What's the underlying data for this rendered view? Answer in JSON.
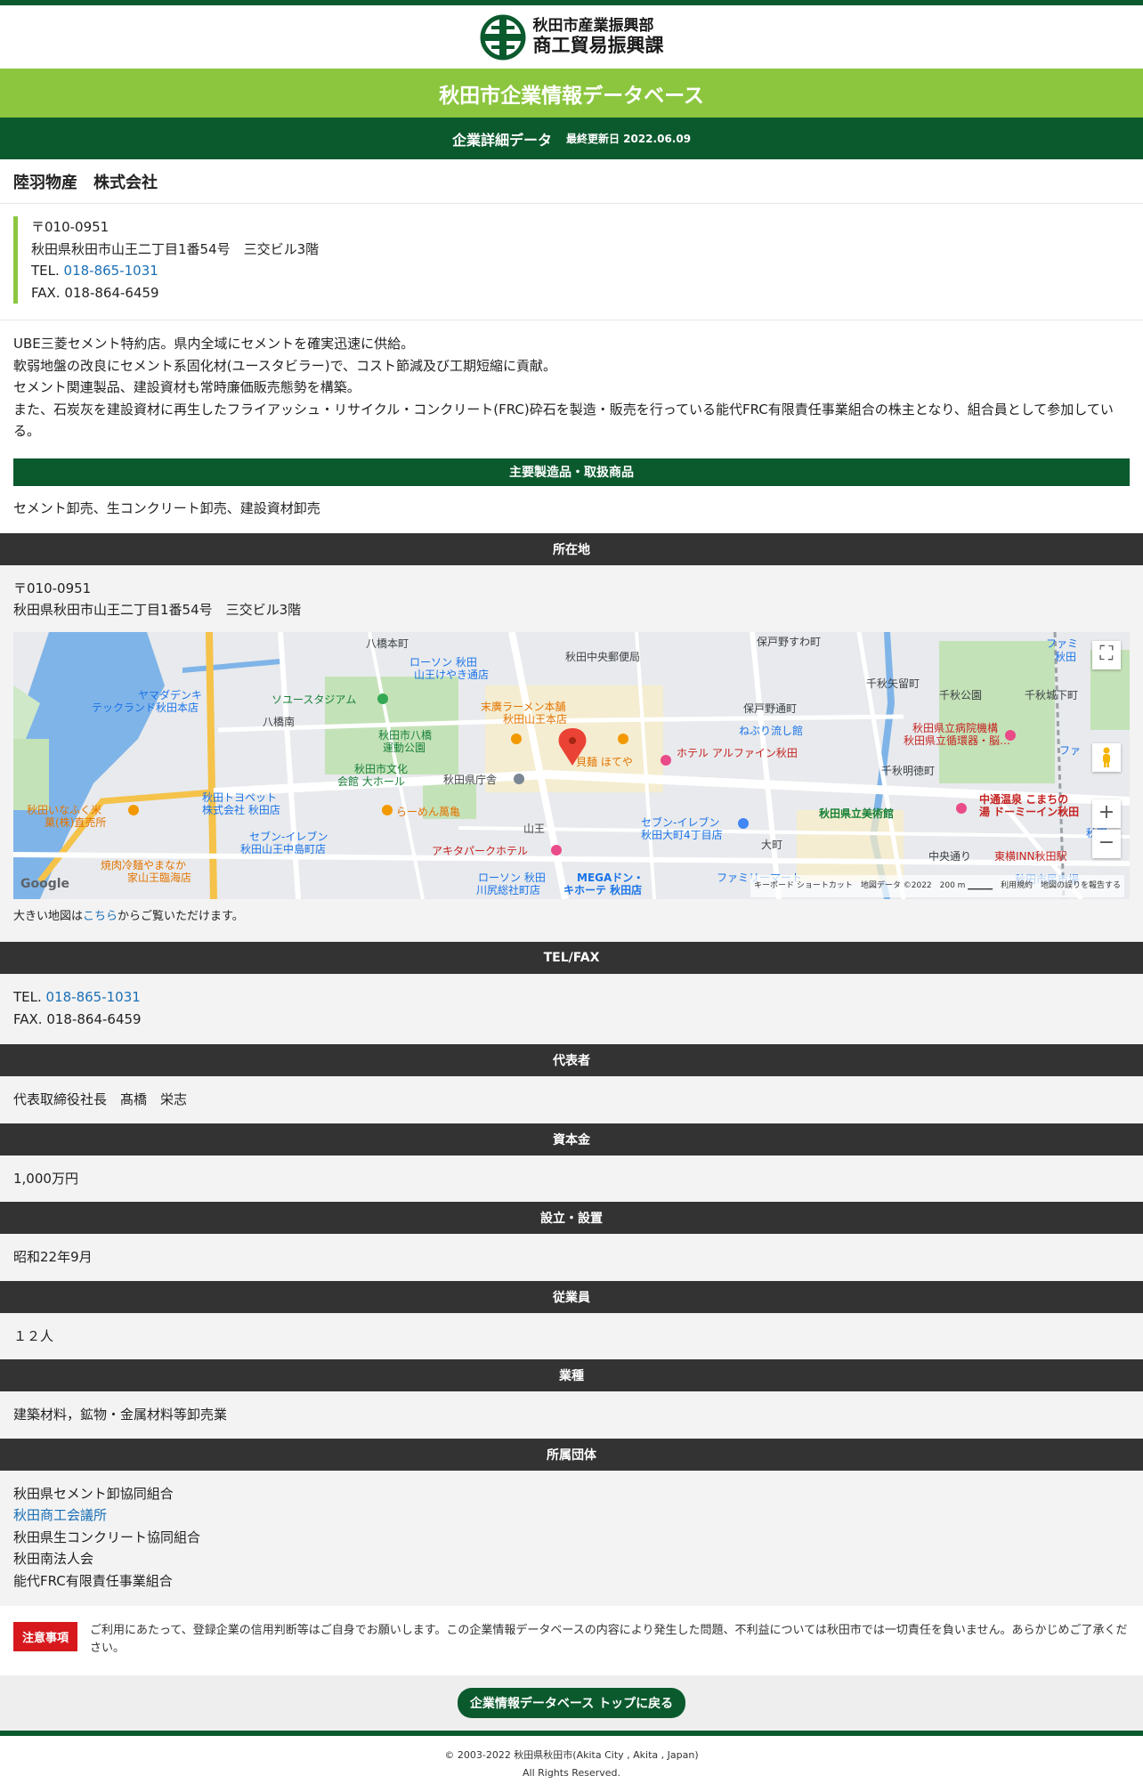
{
  "header": {
    "dept": "秋田市産業振興部",
    "section": "商工貿易振興課",
    "banner": "秋田市企業情報データベース",
    "sub_title": "企業詳細データ",
    "updated": "最終更新日 2022.06.09"
  },
  "company": {
    "name": "陸羽物産　株式会社",
    "zip": "〒010-0951",
    "address": "秋田県秋田市山王二丁目1番54号　三交ビル3階",
    "tel_prefix": "TEL. ",
    "tel": "018-865-1031",
    "fax": "FAX. 018-864-6459"
  },
  "description": [
    "UBE三菱セメント特約店。県内全域にセメントを確実迅速に供給。",
    "軟弱地盤の改良にセメント系固化材(ユースタビラー)で、コスト節減及び工期短縮に貢献。",
    "セメント関連製品、建設資材も常時廉価販売態勢を構築。",
    "また、石炭灰を建設資材に再生したフライアッシュ・リサイクル・コンクリート(FRC)砕石を製造・販売を行っている能代FRC有限責任事業組合の株主となり、組合員として参加している。"
  ],
  "products": {
    "heading": "主要製造品・取扱商品",
    "value": "セメント卸売、生コンクリート卸売、建設資材卸売"
  },
  "location": {
    "heading": "所在地",
    "zip": "〒010-0951",
    "address": "秋田県秋田市山王二丁目1番54号　三交ビル3階",
    "map_note_prefix": "大きい地図は",
    "map_note_link": "こちら",
    "map_note_suffix": "からご覧いただけます。"
  },
  "map": {
    "labels": {
      "l1": "八橋本町",
      "l2": "ローソン 秋田",
      "l3": "山王けやき通店",
      "l4": "秋田中央郵便局",
      "l5": "保戸野すわ町",
      "l6": "ヤマダデンキ",
      "l7": "テックランド秋田本店",
      "l8": "ソユースタジアム",
      "l9": "八橋南",
      "l10": "末廣ラーメン本舗",
      "l11": "秋田山王本店",
      "l12": "保戸野通町",
      "l13": "千秋矢留町",
      "l14": "千秋公園",
      "l15": "千秋城下町",
      "l16": "ねぶり流し館",
      "l17": "秋田市八橋",
      "l18": "運動公園",
      "l19": "秋田県立病院機構",
      "l20": "秋田県立循環器・脳…",
      "l21": "秋田市文化",
      "l22": "会館 大ホール",
      "l23": "秋田県庁舎",
      "l24": "貝麺 ほてや",
      "l25": "ホテル アルファイン秋田",
      "l26": "千秋明徳町",
      "l27": "秋田トヨペット",
      "l28": "株式会社 秋田店",
      "l29": "秋田いなふく米",
      "l30": "菓(株)直売所",
      "l31": "らーめん萬亀",
      "l32": "山王",
      "l33": "セブン-イレブン",
      "l34": "秋田大町4丁目店",
      "l35": "秋田県立美術館",
      "l36": "中通温泉 こまちの",
      "l37": "湯 ドーミーイン秋田",
      "l38": "セブン-イレブン",
      "l39": "秋田山王中島町店",
      "l40": "大町",
      "l41": "中央通り",
      "l42": "東横INN秋田駅",
      "l43": "焼肉冷麺やまなか",
      "l44": "家山王臨海店",
      "l45": "アキタパークホテル",
      "l46": "ローソン 秋田",
      "l47": "川尻総社町店",
      "l48": "MEGAドン・",
      "l49": "キホーテ 秋田店",
      "l50": "ファミリーマート",
      "l51": "秋田市民市場",
      "l52": "ファミ",
      "l53": "秋田",
      "l54": "秋田",
      "l55": "ファ"
    },
    "attribution": "キーボード ショートカット　地図データ ©2022　200 m ▁▁▁▁　利用規約　地図の誤りを報告する",
    "google": "Google",
    "zoom_in": "+",
    "zoom_out": "−",
    "fullscreen": "⛶"
  },
  "telfax": {
    "heading": "TEL/FAX",
    "tel_prefix": "TEL. ",
    "tel": "018-865-1031",
    "fax": "FAX. 018-864-6459"
  },
  "representative": {
    "heading": "代表者",
    "value": "代表取締役社長　髙橋　栄志"
  },
  "capital": {
    "heading": "資本金",
    "value": "1,000万円"
  },
  "established": {
    "heading": "設立・設置",
    "value": "昭和22年9月"
  },
  "employees": {
    "heading": "従業員",
    "value": "１２人"
  },
  "industry": {
    "heading": "業種",
    "value": "建築材料，鉱物・金属材料等卸売業"
  },
  "groups": {
    "heading": "所属団体",
    "g1": "秋田県セメント卸協同組合",
    "g2": "秋田商工会議所",
    "g3": "秋田県生コンクリート協同組合",
    "g4": "秋田南法人会",
    "g5": "能代FRC有限責任事業組合"
  },
  "notice": {
    "badge": "注意事項",
    "text": "ご利用にあたって、登録企業の信用判断等はご自身でお願いします。この企業情報データベースの内容により発生した問題、不利益については秋田市では一切責任を負いません。あらかじめご了承ください。"
  },
  "back_button": "企業情報データベース トップに戻る",
  "footer": {
    "copyright": "© 2003-2022 秋田県秋田市(Akita City , Akita , Japan)",
    "rights": "All Rights Reserved."
  },
  "colors": {
    "dark_green": "#0b5a2e",
    "light_green": "#8cc63f",
    "dark_head": "#333333",
    "notice_red": "#d7191e",
    "link_blue": "#1a6fb5"
  }
}
